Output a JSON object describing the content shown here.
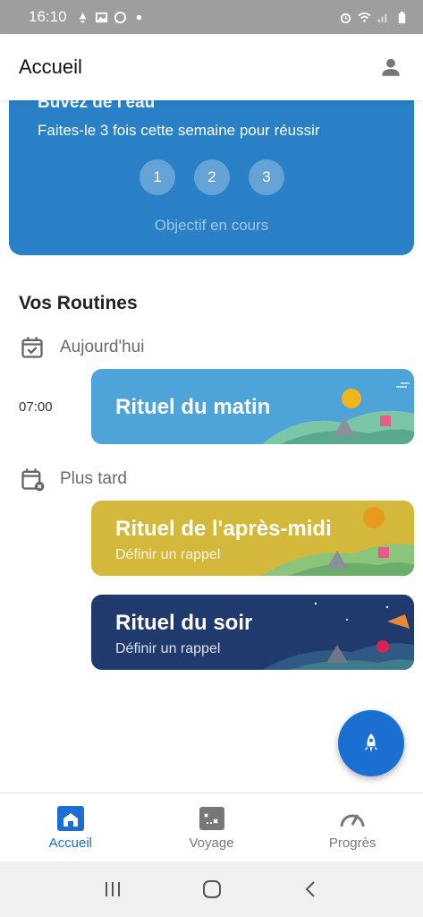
{
  "status_bar": {
    "time": "16:10",
    "left_icons": [
      "notification-icon",
      "gallery-icon",
      "whatsapp-icon",
      "dot-icon"
    ],
    "right_icons": [
      "alarm-icon",
      "wifi-icon",
      "signal-icon",
      "battery-icon"
    ]
  },
  "app_bar": {
    "title": "Accueil",
    "profile_icon": "person-icon"
  },
  "goal": {
    "title": "Buvez de l'eau",
    "subtitle": "Faites-le 3 fois cette semaine pour réussir",
    "steps": [
      "1",
      "2",
      "3"
    ],
    "status": "Objectif en cours"
  },
  "routines": {
    "section_title": "Vos Routines",
    "today_label": "Aujourd'hui",
    "later_label": "Plus tard",
    "items": [
      {
        "title": "Rituel du matin",
        "time": "07:00",
        "subtitle": "",
        "color": "#4ea3d9"
      },
      {
        "title": "Rituel de l'après-midi",
        "time": "",
        "subtitle": "Définir un rappel",
        "color": "#d4b83b"
      },
      {
        "title": "Rituel du soir",
        "time": "",
        "subtitle": "Définir un rappel",
        "color": "#203a6e"
      }
    ]
  },
  "fab": {
    "icon": "rocket-icon",
    "color": "#1b6fd3"
  },
  "bottom_nav": {
    "items": [
      {
        "label": "Accueil",
        "icon": "home-icon",
        "active": true
      },
      {
        "label": "Voyage",
        "icon": "map-icon",
        "active": false
      },
      {
        "label": "Progrès",
        "icon": "gauge-icon",
        "active": false
      }
    ]
  },
  "system_nav": [
    "recents-icon",
    "home-circle-icon",
    "back-icon"
  ],
  "colors": {
    "accent": "#1b6fd3",
    "goal_card": "#2a80c6"
  }
}
